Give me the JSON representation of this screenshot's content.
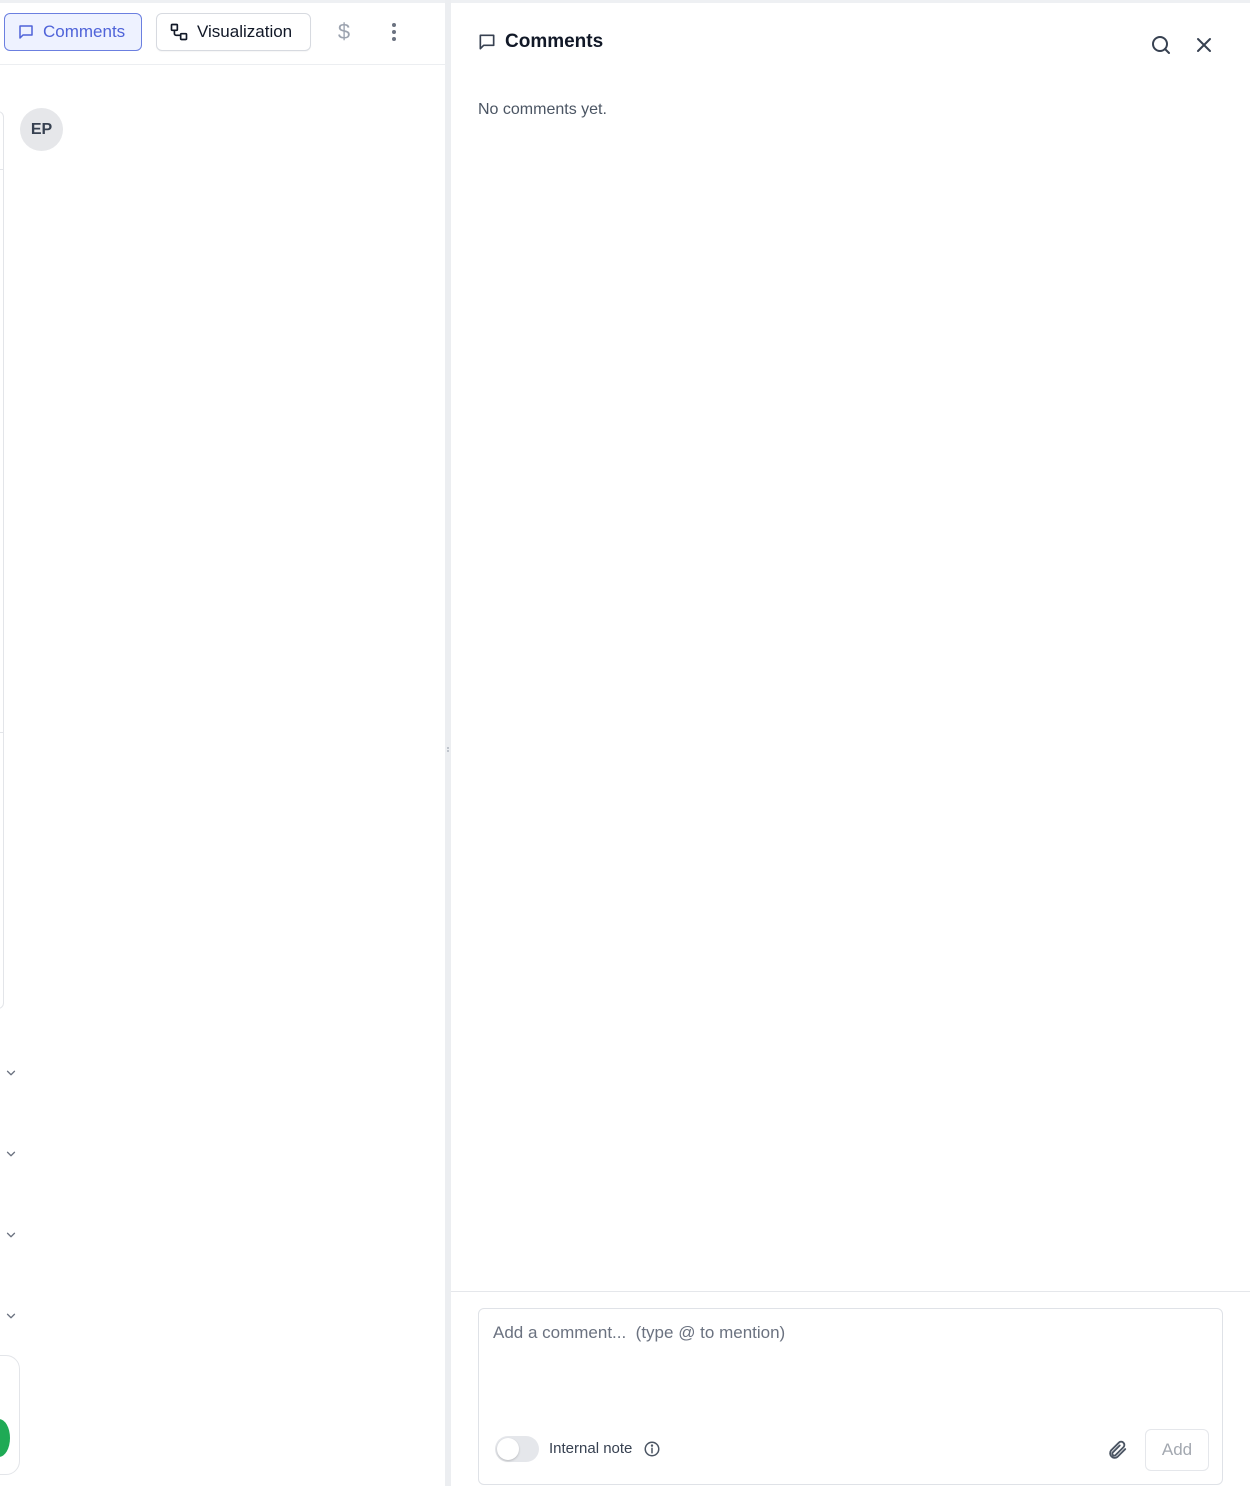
{
  "toolbar": {
    "comments_label": "Comments",
    "visualization_label": "Visualization",
    "currency_symbol": "$"
  },
  "record": {
    "avatar_initials": "EP"
  },
  "panel": {
    "title": "Comments",
    "empty_text": "No comments yet.",
    "composer": {
      "placeholder": "Add a comment...  (type @ to mention)",
      "value": "",
      "internal_note_label": "Internal note",
      "internal_note_on": false,
      "add_label": "Add"
    }
  },
  "colors": {
    "accent": "#4f63d9",
    "accent_bg": "#eef2ff",
    "status_green": "#1faa55"
  }
}
